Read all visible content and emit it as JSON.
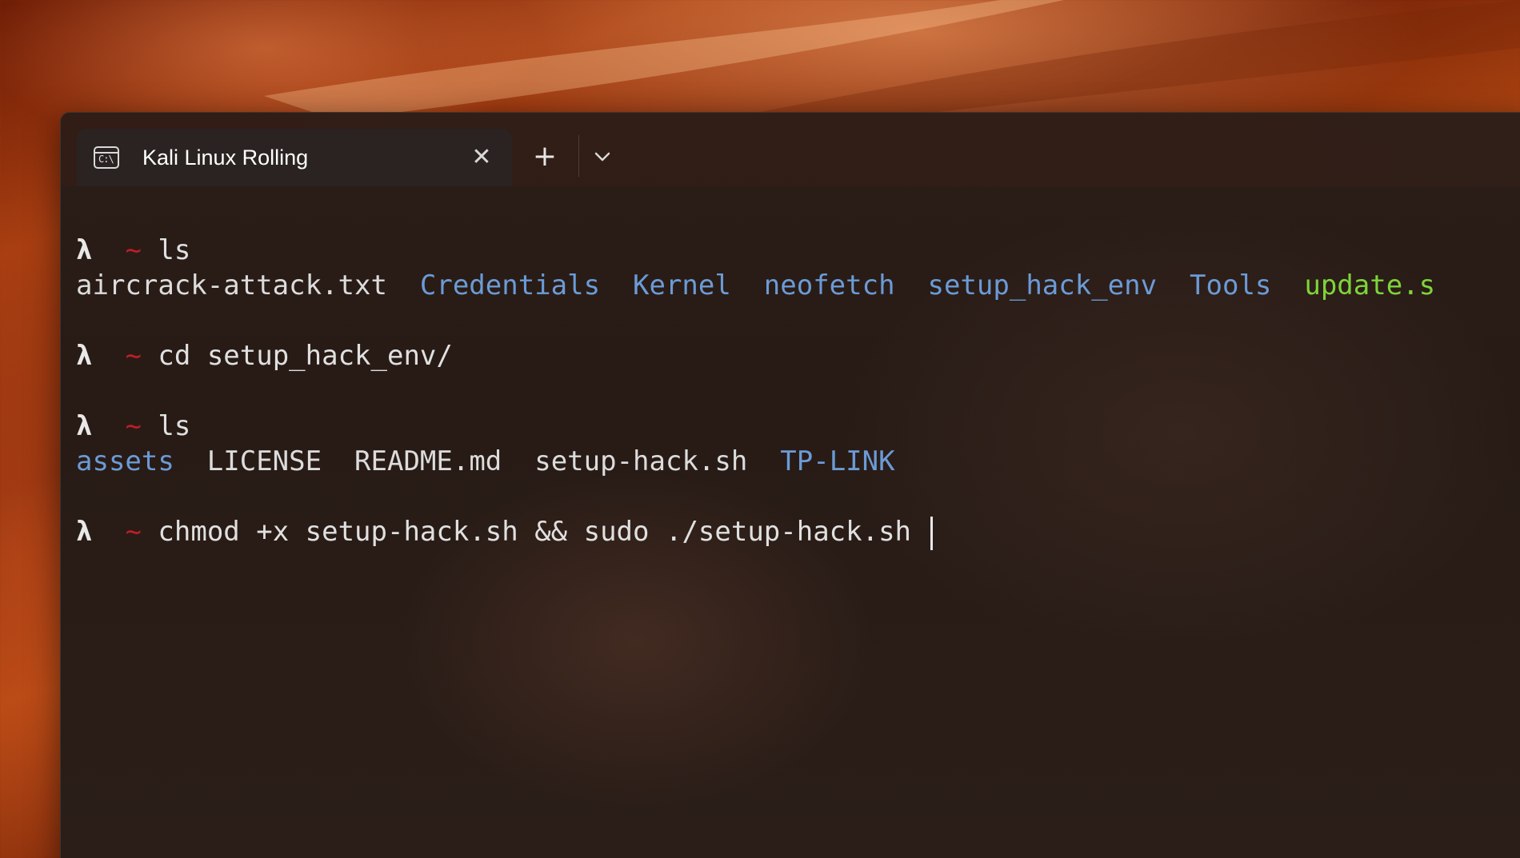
{
  "window": {
    "tab": {
      "title": "Kali Linux Rolling",
      "icon": "terminal-icon",
      "icon_text": "C:\\"
    },
    "new_tab_label": "+",
    "close_glyph": "✕",
    "dropdown_icon": "chevron-down-icon"
  },
  "prompt": {
    "lambda": "λ",
    "tilde": "~"
  },
  "terminal": {
    "lines": [
      {
        "kind": "command",
        "command": "ls"
      },
      {
        "kind": "listing",
        "entries": [
          {
            "name": "aircrack-attack.txt",
            "type": "file"
          },
          {
            "name": "Credentials",
            "type": "dir"
          },
          {
            "name": "Kernel",
            "type": "dir"
          },
          {
            "name": "neofetch",
            "type": "dir"
          },
          {
            "name": "setup_hack_env",
            "type": "dir"
          },
          {
            "name": "Tools",
            "type": "dir"
          },
          {
            "name": "update.s",
            "type": "exec"
          }
        ]
      },
      {
        "kind": "command",
        "command": "cd setup_hack_env/"
      },
      {
        "kind": "command",
        "command": "ls"
      },
      {
        "kind": "listing",
        "entries": [
          {
            "name": "assets",
            "type": "dir"
          },
          {
            "name": "LICENSE",
            "type": "file"
          },
          {
            "name": "README.md",
            "type": "file"
          },
          {
            "name": "setup-hack.sh",
            "type": "file"
          },
          {
            "name": "TP-LINK",
            "type": "dir"
          }
        ]
      },
      {
        "kind": "command",
        "command": "chmod +x setup-hack.sh && sudo ./setup-hack.sh ",
        "cursor": true
      }
    ]
  },
  "colors": {
    "directory": "#6b9bd6",
    "executable": "#7ed43a",
    "prompt_tilde": "#c01c28",
    "text": "#d4d4d4"
  }
}
